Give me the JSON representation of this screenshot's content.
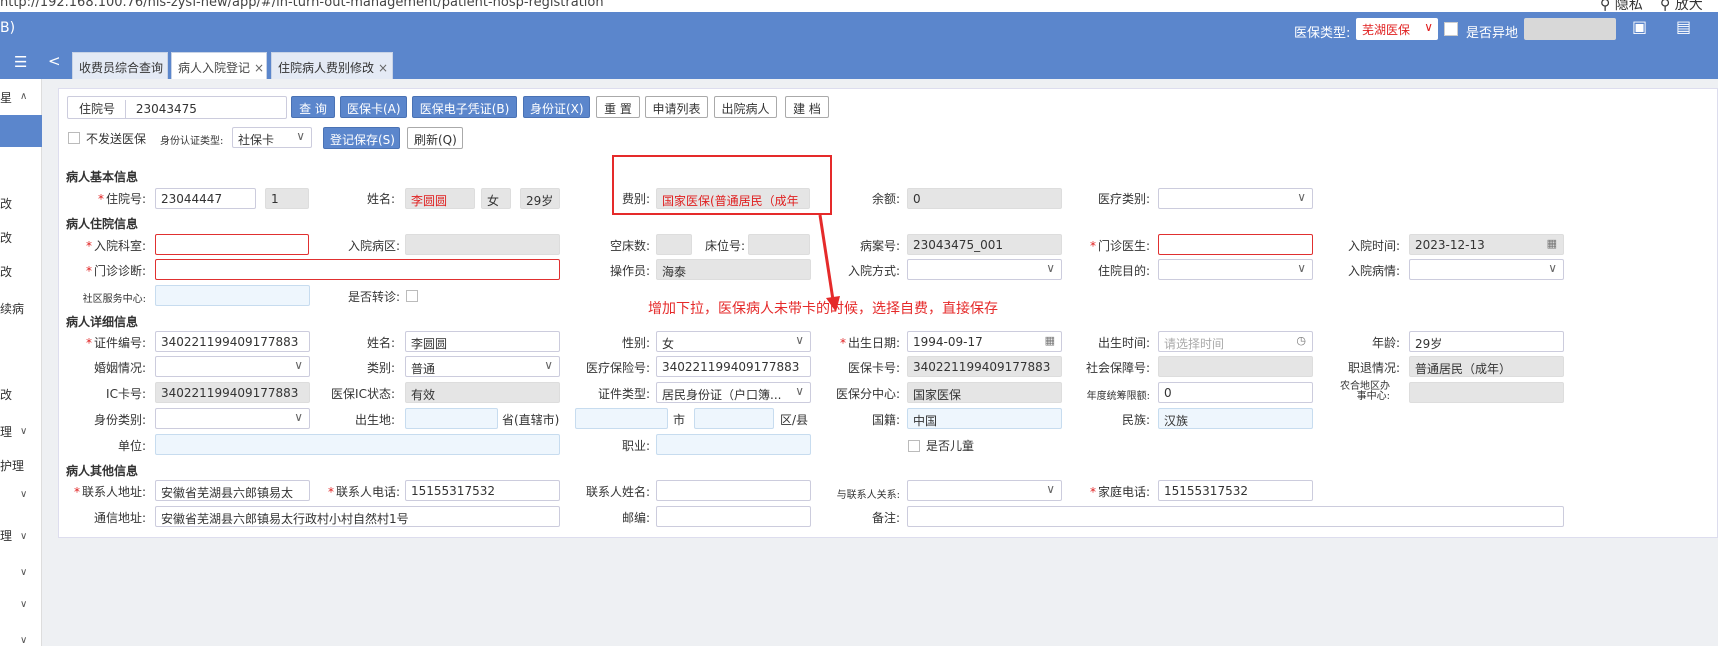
{
  "browser": {
    "url": "http://192.168.100.76/his-zysf-new/app/#/in-turn-out-management/patient-hosp-registration",
    "right_label_1": "隐私",
    "right_label_2": "放大"
  },
  "header": {
    "logo": "B)",
    "ins_type_label": "医保类型:",
    "ins_type_value": "芜湖医保",
    "other_place_label": "是否异地"
  },
  "tabs": [
    {
      "label": "收费员综合查询"
    },
    {
      "label": "病人入院登记"
    },
    {
      "label": "住院病人费别修改"
    }
  ],
  "sidebar": {
    "items": [
      "星",
      "改",
      "改",
      "改",
      "续病",
      "改",
      "理",
      "护理",
      "理"
    ]
  },
  "toolbar": {
    "hosp_no_label": "住院号",
    "hosp_no_value": "23043475",
    "query": "查 询",
    "ins_card": "医保卡(A)",
    "ins_e_cert": "医保电子凭证(B)",
    "id_card": "身份证(X)",
    "reset": "重 置",
    "apply_list": "申请列表",
    "discharged": "出院病人",
    "create_file": "建 档",
    "no_send_ins": "不发送医保",
    "auth_type_label": "身份认证类型:",
    "auth_type_value": "社保卡",
    "save": "登记保存(S)",
    "refresh": "刷新(Q)"
  },
  "basic": {
    "title": "病人基本信息",
    "hosp_no_label": "住院号:",
    "hosp_no": "23044447",
    "times": "1",
    "name_label": "姓名:",
    "name": "李圆圆",
    "sex": "女",
    "age": "29岁",
    "fee_type_label": "费别:",
    "fee_type": "国家医保(普通居民（成年",
    "balance_label": "余额:",
    "balance": "0",
    "med_category_label": "医疗类别:"
  },
  "admission": {
    "title": "病人住院信息",
    "dept_label": "入院科室:",
    "ward_label": "入院病区:",
    "empty_beds_label": "空床数:",
    "bed_no_label": "床位号:",
    "case_no_label": "病案号:",
    "case_no": "23043475_001",
    "clinic_doctor_label": "门诊医生:",
    "adm_time_label": "入院时间:",
    "adm_time": "2023-12-13",
    "clinic_diag_label": "门诊诊断:",
    "operator_label": "操作员:",
    "operator": "海泰",
    "adm_way_label": "入院方式:",
    "adm_purpose_label": "住院目的:",
    "adm_condition_label": "入院病情:",
    "community_label": "社区服务中心:",
    "transfer_label": "是否转诊:"
  },
  "detail": {
    "title": "病人详细信息",
    "id_no_label": "证件编号:",
    "id_no": "340221199409177883",
    "name_label": "姓名:",
    "name": "李圆圆",
    "sex_label": "性别:",
    "sex": "女",
    "birth_date_label": "出生日期:",
    "birth_date": "1994-09-17",
    "birth_time_label": "出生时间:",
    "birth_time_placeholder": "请选择时间",
    "age_label": "年龄:",
    "age": "29岁",
    "marital_label": "婚姻情况:",
    "category_label": "类别:",
    "category": "普通",
    "ins_no_label": "医疗保险号:",
    "ins_no": "340221199409177883",
    "ins_card_no_label": "医保卡号:",
    "ins_card_no": "340221199409177883",
    "social_no_label": "社会保障号:",
    "job_status_label": "职退情况:",
    "job_status": "普通居民（成年）",
    "ic_label": "IC卡号:",
    "ic": "340221199409177883",
    "ic_status_label": "医保IC状态:",
    "ic_status": "有效",
    "cert_type_label": "证件类型:",
    "cert_type": "居民身份证（户口簿...",
    "ins_center_label": "医保分中心:",
    "ins_center": "国家医保",
    "annual_limit_label": "年度统筹限额:",
    "annual_limit": "0",
    "rural_center_label": "农合地区办事中心:",
    "identity_label": "身份类别:",
    "birthplace_label": "出生地:",
    "province_label": "省(直辖市)",
    "city_label": "市",
    "district_label": "区/县",
    "nationality_label": "国籍:",
    "nationality": "中国",
    "ethnicity_label": "民族:",
    "ethnicity": "汉族",
    "work_unit_label": "单位:",
    "occupation_label": "职业:",
    "is_child_label": "是否儿童"
  },
  "other": {
    "title": "病人其他信息",
    "contact_addr_label": "联系人地址:",
    "contact_addr": "安徽省芜湖县六郎镇易太",
    "contact_phone_label": "联系人电话:",
    "contact_phone": "15155317532",
    "contact_name_label": "联系人姓名:",
    "relation_label": "与联系人关系:",
    "home_phone_label": "家庭电话:",
    "home_phone": "15155317532",
    "mail_addr_label": "通信地址:",
    "mail_addr": "安徽省芜湖县六郎镇易太行政村小村自然村1号",
    "postcode_label": "邮编:",
    "remark_label": "备注:"
  },
  "annotation": {
    "text": "增加下拉，医保病人未带卡的时候，选择自费，直接保存"
  },
  "colors": {
    "header": "#5b86cc",
    "annotation": "#e52a2a",
    "required": "#e02020"
  }
}
